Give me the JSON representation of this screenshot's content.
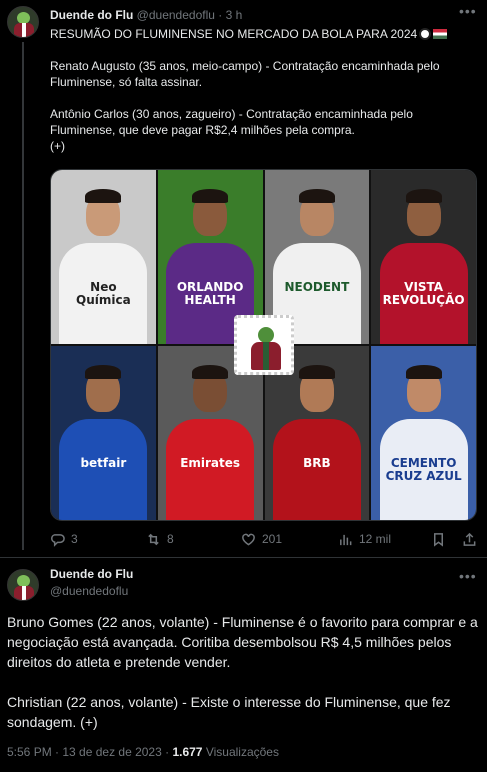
{
  "tweet1": {
    "author_name": "Duende do Flu",
    "handle": "@duendedoflu",
    "separator": "·",
    "time": "3 h",
    "headline": "RESUMÃO DO FLUMINENSE NO MERCADO DA BOLA PARA 2024",
    "paragraph1": "Renato Augusto (35 anos, meio-campo) - Contratação encaminhada pelo Fluminense, só falta assinar.",
    "paragraph2": "Antônio Carlos (30 anos, zagueiro) - Contratação encaminhada pelo Fluminense, que deve pagar R$2,4 milhões pela compra.",
    "paragraph3": "(+)",
    "media": {
      "panels": [
        {
          "sponsor": "Neo\nQuímica",
          "bg": "#c9c9c9",
          "shirt": "#f2f2f2",
          "text": "#222222"
        },
        {
          "sponsor": "ORLANDO\nHEALTH",
          "bg": "#3a7d2a",
          "shirt": "#5b2a86",
          "text": "#ffffff"
        },
        {
          "sponsor": "NEODENT",
          "bg": "#7a7a7a",
          "shirt": "#f0f0f0",
          "text": "#1d5a2c"
        },
        {
          "sponsor": "VISTA\nREVOLUÇÃO",
          "bg": "#2a2a2a",
          "shirt": "#b3122b",
          "text": "#ffffff"
        },
        {
          "sponsor": "betfair",
          "bg": "#1a2e55",
          "shirt": "#1e4fb5",
          "text": "#ffffff"
        },
        {
          "sponsor": "Emirates",
          "bg": "#5a5a5a",
          "shirt": "#d11a24",
          "text": "#ffffff"
        },
        {
          "sponsor": "BRB",
          "bg": "#3a3a3a",
          "shirt": "#b3121b",
          "text": "#ffffff"
        },
        {
          "sponsor": "CEMENTO\nCRUZ AZUL",
          "bg": "#3b5fa8",
          "shirt": "#e9edf5",
          "text": "#1a3d8f"
        }
      ]
    },
    "actions": {
      "replies": "3",
      "retweets": "8",
      "likes": "201",
      "views": "12 mil"
    }
  },
  "tweet2": {
    "author_name": "Duende do Flu",
    "handle": "@duendedoflu",
    "paragraph1": "Bruno Gomes (22 anos, volante) - Fluminense é o favorito para comprar e a negociação está avançada. Coritiba desembolsou R$ 4,5 milhões pelos direitos do atleta e pretende vender.",
    "paragraph2": "Christian (22 anos, volante) - Existe o interesse do Fluminense, que fez sondagem. (+)",
    "timestamp": "5:56 PM · 13 de dez de 2023 · ",
    "views_count": "1.677",
    "views_label": " Visualizações"
  },
  "colors": {
    "background": "#000000",
    "text": "#e7e9ea",
    "muted": "#71767b",
    "border": "#2f3336"
  },
  "icons": {
    "reply": "speech-bubble-icon",
    "retweet": "retweet-icon",
    "like": "heart-icon",
    "views": "bar-chart-icon",
    "bookmark": "bookmark-icon",
    "share": "share-icon",
    "more": "more-dots-icon"
  }
}
